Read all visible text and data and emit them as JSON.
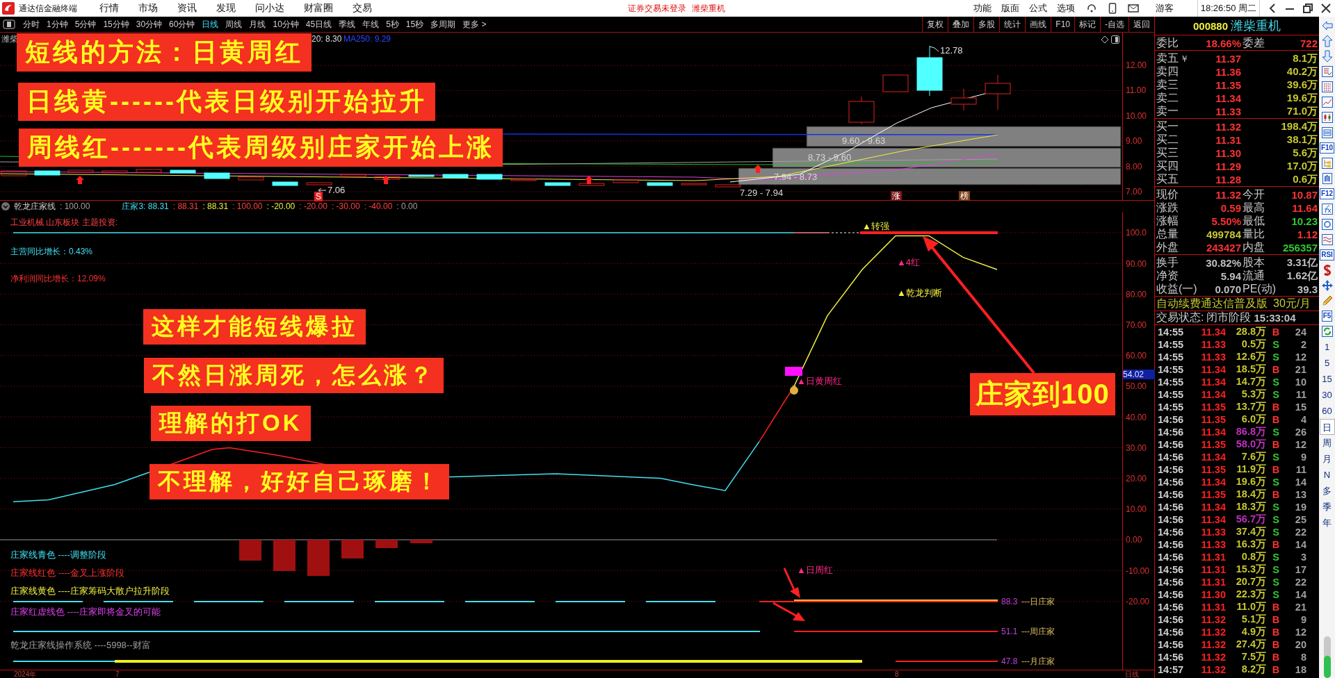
{
  "menubar": {
    "app_name": "通达信金融终端",
    "menus": [
      "行情",
      "市场",
      "资讯",
      "发现",
      "问小达",
      "财富圈",
      "交易"
    ],
    "notice": "证券交易未登录",
    "stock": "潍柴重机",
    "functions": [
      "功能",
      "版面",
      "公式",
      "选项"
    ],
    "user": "游客",
    "clock": "18:26:50 周二"
  },
  "periods": [
    {
      "label": "分时",
      "selected": false
    },
    {
      "label": "1分钟",
      "selected": false
    },
    {
      "label": "5分钟",
      "selected": false
    },
    {
      "label": "15分钟",
      "selected": false
    },
    {
      "label": "30分钟",
      "selected": false
    },
    {
      "label": "60分钟",
      "selected": false
    },
    {
      "label": "日线",
      "selected": true
    },
    {
      "label": "周线",
      "selected": false
    },
    {
      "label": "月线",
      "selected": false
    },
    {
      "label": "10分钟",
      "selected": false
    },
    {
      "label": "45日线",
      "selected": false
    },
    {
      "label": "季线",
      "selected": false
    },
    {
      "label": "年线",
      "selected": false
    },
    {
      "label": "5秒",
      "selected": false
    },
    {
      "label": "15秒",
      "selected": false
    },
    {
      "label": "多周期",
      "selected": false
    },
    {
      "label": "更多 >",
      "selected": false
    }
  ],
  "chart_tools": [
    "复权",
    "叠加",
    "多股",
    "统计",
    "画线",
    "F10",
    "标记",
    "-自选",
    "返回"
  ],
  "price_chart": {
    "title": "潍柴",
    "ma_labels": [
      {
        "text": "20: 8.30",
        "color": "#e0e0e0"
      },
      {
        "text": "MA250: 9.29",
        "color": "#2848ff"
      }
    ],
    "axis": [
      "12.00",
      "11.00",
      "10.00",
      "9.00",
      "8.00",
      "7.00"
    ],
    "high_label": "12.78",
    "low_label": "7.06",
    "chip_zones": [
      "9.60 - 9.63",
      "8.73 - 9.60",
      "7.94 - 8.73",
      "7.29 - 7.94"
    ],
    "badges": [
      {
        "text": "S",
        "color": "#e02020"
      },
      {
        "text": "涨",
        "color": "#801818"
      },
      {
        "text": "榜",
        "color": "#804018"
      }
    ],
    "banners": [
      "短线的方法：日黄周红",
      "日线黄------代表日级别开始拉升",
      "周线红-------代表周级别庄家开始上涨"
    ]
  },
  "indicator": {
    "name": "乾龙庄家线",
    "header": [
      {
        "text": ": 100.00",
        "color": "#a0a0a0"
      },
      {
        "text": "庄家3: 88.31",
        "color": "#40e0f0"
      },
      {
        "text": ": 88.31",
        "color": "#ff4040"
      },
      {
        "text": ": 88.31",
        "color": "#f0f040"
      },
      {
        "text": ": 100.00",
        "color": "#ff4040"
      },
      {
        "text": ": -20.00",
        "color": "#f0f040"
      },
      {
        "text": ": -20.00",
        "color": "#ff4040"
      },
      {
        "text": ": -30.00",
        "color": "#ff4040"
      },
      {
        "text": ": -40.00",
        "color": "#ff4040"
      },
      {
        "text": ": 0.00",
        "color": "#a0a0a0"
      }
    ],
    "info": [
      {
        "text": "工业机械 山东板块 主题投资:",
        "color": "#ff4040"
      },
      {
        "text": "主营同比增长：0.43%",
        "color": "#40e0f0"
      },
      {
        "text": "净利润同比增长：12.09%",
        "color": "#ff3030"
      }
    ],
    "axis": [
      "100.0",
      "90.00",
      "80.00",
      "70.00",
      "60.00",
      "50.00",
      "40.00",
      "30.00",
      "20.00",
      "10.00",
      "0.00",
      "-10.00",
      "-20.00"
    ],
    "current": "54.02",
    "signals": [
      {
        "text": "▲转强",
        "color": "#f0f040"
      },
      {
        "text": "▲4红",
        "color": "#ff2a8a"
      },
      {
        "text": "▲乾龙判断",
        "color": "#f0f040"
      },
      {
        "text": "▲日黄周红",
        "color": "#ff2a8a"
      },
      {
        "text": "▲日周红",
        "color": "#ff2a8a"
      }
    ],
    "banners": [
      "这样才能短线爆拉",
      "不然日涨周死，怎么涨？",
      "理解的打OK",
      "不理解，好好自己琢磨！",
      "庄家到100"
    ],
    "legend": [
      {
        "text": "庄家线青色 ----调整阶段",
        "color": "#40e0f0"
      },
      {
        "text": "庄家线红色 ----金叉上涨阶段",
        "color": "#ff3030"
      },
      {
        "text": "庄家线黄色 ----庄家筹码大散户拉升阶段",
        "color": "#f0f040"
      },
      {
        "text": "庄家红虚线色 ----庄家即将金叉的可能",
        "color": "#e040f0"
      },
      {
        "text": "乾龙庄家线操作系统 ----5998--财富",
        "color": "#a0a0a0"
      }
    ],
    "house_lines": [
      {
        "value": "88.3",
        "label": "---日庄家"
      },
      {
        "value": "51.1",
        "label": "---周庄家"
      },
      {
        "value": "47.8",
        "label": "---月庄家"
      }
    ]
  },
  "date_axis": [
    "2024年",
    "7",
    "8",
    "日线"
  ],
  "quote": {
    "code": "000880",
    "name": "潍柴重机",
    "ratio": {
      "label": "委比",
      "value": "18.66%",
      "label2": "委差",
      "value2": "722"
    },
    "asks": [
      {
        "label": "卖五",
        "note": "￥",
        "price": "11.37",
        "volume": "8.1万"
      },
      {
        "label": "卖四",
        "price": "11.36",
        "volume": "40.2万"
      },
      {
        "label": "卖三",
        "price": "11.35",
        "volume": "39.6万"
      },
      {
        "label": "卖二",
        "price": "11.34",
        "volume": "19.6万"
      },
      {
        "label": "卖一",
        "price": "11.33",
        "volume": "71.0万"
      }
    ],
    "bids": [
      {
        "label": "买一",
        "price": "11.32",
        "volume": "198.4万"
      },
      {
        "label": "买二",
        "price": "11.31",
        "volume": "38.1万"
      },
      {
        "label": "买三",
        "price": "11.30",
        "volume": "5.6万"
      },
      {
        "label": "买四",
        "price": "11.29",
        "volume": "17.0万"
      },
      {
        "label": "买五",
        "price": "11.28",
        "volume": "0.6万"
      }
    ],
    "stats": [
      {
        "cells": [
          {
            "label": "现价",
            "value": "11.32",
            "color": "#ff3232"
          },
          {
            "label": "今开",
            "value": "10.87",
            "color": "#ff3232"
          }
        ]
      },
      {
        "cells": [
          {
            "label": "涨跌",
            "value": "0.59",
            "color": "#ff3232"
          },
          {
            "label": "最高",
            "value": "11.64",
            "color": "#ff3232"
          }
        ]
      },
      {
        "cells": [
          {
            "label": "涨幅",
            "value": "5.50%",
            "color": "#ff3232"
          },
          {
            "label": "最低",
            "value": "10.23",
            "color": "#32c832"
          }
        ]
      },
      {
        "cells": [
          {
            "label": "总量",
            "value": "499784",
            "color": "#c8c832"
          },
          {
            "label": "量比",
            "value": "1.12",
            "color": "#ff3232"
          }
        ]
      },
      {
        "cells": [
          {
            "label": "外盘",
            "value": "243427",
            "color": "#ff3232"
          },
          {
            "label": "内盘",
            "value": "256357",
            "color": "#32c832"
          }
        ]
      }
    ],
    "fundamentals": [
      {
        "label": "换手",
        "value": "30.82%",
        "label2": "股本",
        "value2": "3.31亿"
      },
      {
        "label": "净资",
        "value": "5.94",
        "label2": "流通",
        "value2": "1.62亿"
      },
      {
        "label": "收益(一)",
        "value": "0.070",
        "label2": "PE(动)",
        "value2": "39.3"
      }
    ],
    "promo": {
      "text": "自动续费通达信普及版",
      "price": "30元/月"
    },
    "status": {
      "label": "交易状态:",
      "value": "闭市阶段",
      "time": "15:33:04"
    },
    "ticks": [
      {
        "time": "14:55",
        "price": "11.34",
        "volume": "28.8万",
        "side": "B",
        "kind": "buy",
        "count": "24",
        "large": false
      },
      {
        "time": "14:55",
        "price": "11.33",
        "volume": "0.5万",
        "side": "S",
        "kind": "sell",
        "count": "2",
        "large": false
      },
      {
        "time": "14:55",
        "price": "11.33",
        "volume": "12.6万",
        "side": "S",
        "kind": "sell",
        "count": "12",
        "large": false
      },
      {
        "time": "14:55",
        "price": "11.34",
        "volume": "18.5万",
        "side": "B",
        "kind": "buy",
        "count": "21",
        "large": false
      },
      {
        "time": "14:55",
        "price": "11.34",
        "volume": "14.7万",
        "side": "S",
        "kind": "sell",
        "count": "10",
        "large": false
      },
      {
        "time": "14:55",
        "price": "11.34",
        "volume": "5.3万",
        "side": "S",
        "kind": "sell",
        "count": "11",
        "large": false
      },
      {
        "time": "14:55",
        "price": "11.35",
        "volume": "13.7万",
        "side": "B",
        "kind": "buy",
        "count": "15",
        "large": false
      },
      {
        "time": "14:56",
        "price": "11.35",
        "volume": "6.0万",
        "side": "B",
        "kind": "buy",
        "count": "4",
        "large": false
      },
      {
        "time": "14:56",
        "price": "11.34",
        "volume": "86.8万",
        "side": "S",
        "kind": "sell",
        "count": "26",
        "large": true
      },
      {
        "time": "14:56",
        "price": "11.35",
        "volume": "58.0万",
        "side": "B",
        "kind": "buy",
        "count": "12",
        "large": true
      },
      {
        "time": "14:56",
        "price": "11.34",
        "volume": "7.6万",
        "side": "S",
        "kind": "sell",
        "count": "9",
        "large": false
      },
      {
        "time": "14:56",
        "price": "11.35",
        "volume": "11.9万",
        "side": "B",
        "kind": "buy",
        "count": "11",
        "large": false
      },
      {
        "time": "14:56",
        "price": "11.34",
        "volume": "19.6万",
        "side": "S",
        "kind": "sell",
        "count": "14",
        "large": false
      },
      {
        "time": "14:56",
        "price": "11.35",
        "volume": "18.4万",
        "side": "B",
        "kind": "buy",
        "count": "13",
        "large": false
      },
      {
        "time": "14:56",
        "price": "11.34",
        "volume": "18.3万",
        "side": "S",
        "kind": "sell",
        "count": "19",
        "large": false
      },
      {
        "time": "14:56",
        "price": "11.34",
        "volume": "56.7万",
        "side": "S",
        "kind": "sell",
        "count": "25",
        "large": true
      },
      {
        "time": "14:56",
        "price": "11.33",
        "volume": "37.4万",
        "side": "S",
        "kind": "sell",
        "count": "22",
        "large": false
      },
      {
        "time": "14:56",
        "price": "11.33",
        "volume": "16.3万",
        "side": "B",
        "kind": "buy",
        "count": "14",
        "large": false
      },
      {
        "time": "14:56",
        "price": "11.31",
        "volume": "0.8万",
        "side": "S",
        "kind": "sell",
        "count": "3",
        "large": false
      },
      {
        "time": "14:56",
        "price": "11.31",
        "volume": "15.3万",
        "side": "S",
        "kind": "sell",
        "count": "17",
        "large": false
      },
      {
        "time": "14:56",
        "price": "11.31",
        "volume": "20.7万",
        "side": "S",
        "kind": "sell",
        "count": "22",
        "large": false
      },
      {
        "time": "14:56",
        "price": "11.30",
        "volume": "22.3万",
        "side": "S",
        "kind": "sell",
        "count": "14",
        "large": false
      },
      {
        "time": "14:56",
        "price": "11.31",
        "volume": "11.0万",
        "side": "B",
        "kind": "buy",
        "count": "21",
        "large": false
      },
      {
        "time": "14:56",
        "price": "11.32",
        "volume": "5.1万",
        "side": "B",
        "kind": "buy",
        "count": "9",
        "large": false
      },
      {
        "time": "14:56",
        "price": "11.32",
        "volume": "4.9万",
        "side": "B",
        "kind": "buy",
        "count": "12",
        "large": false
      },
      {
        "time": "14:56",
        "price": "11.32",
        "volume": "27.4万",
        "side": "B",
        "kind": "buy",
        "count": "20",
        "large": false
      },
      {
        "time": "14:56",
        "price": "11.32",
        "volume": "7.5万",
        "side": "B",
        "kind": "buy",
        "count": "8",
        "large": false
      },
      {
        "time": "14:57",
        "price": "11.32",
        "volume": "8.2万",
        "side": "B",
        "kind": "buy",
        "count": "18",
        "large": false
      }
    ]
  },
  "strip": {
    "tools": [
      {
        "kind": "icon"
      },
      {
        "kind": "icon"
      },
      {
        "kind": "icon"
      },
      {
        "kind": "icon"
      },
      {
        "kind": "icon"
      },
      {
        "kind": "icon"
      },
      {
        "kind": "icon"
      },
      {
        "kind": "icon"
      },
      {
        "kind": "text",
        "label": "F10"
      },
      {
        "kind": "icon"
      },
      {
        "kind": "text",
        "label": "自"
      },
      {
        "kind": "text",
        "label": "F12"
      },
      {
        "kind": "icon"
      },
      {
        "kind": "icon"
      },
      {
        "kind": "icon"
      },
      {
        "kind": "text",
        "label": "RSI"
      },
      {
        "kind": "icon"
      },
      {
        "kind": "icon"
      },
      {
        "kind": "icon"
      },
      {
        "kind": "text",
        "label": "F5"
      },
      {
        "kind": "icon"
      }
    ],
    "periods": [
      {
        "label": "1",
        "selected": false
      },
      {
        "label": "5",
        "selected": false
      },
      {
        "label": "15",
        "selected": false
      },
      {
        "label": "30",
        "selected": false
      },
      {
        "label": "60",
        "selected": false
      },
      {
        "label": "日",
        "selected": true
      },
      {
        "label": "周",
        "selected": false
      },
      {
        "label": "月",
        "selected": false
      },
      {
        "label": "N",
        "selected": false
      },
      {
        "label": "多",
        "selected": false
      },
      {
        "label": "季",
        "selected": false
      },
      {
        "label": "年",
        "selected": false
      }
    ]
  }
}
